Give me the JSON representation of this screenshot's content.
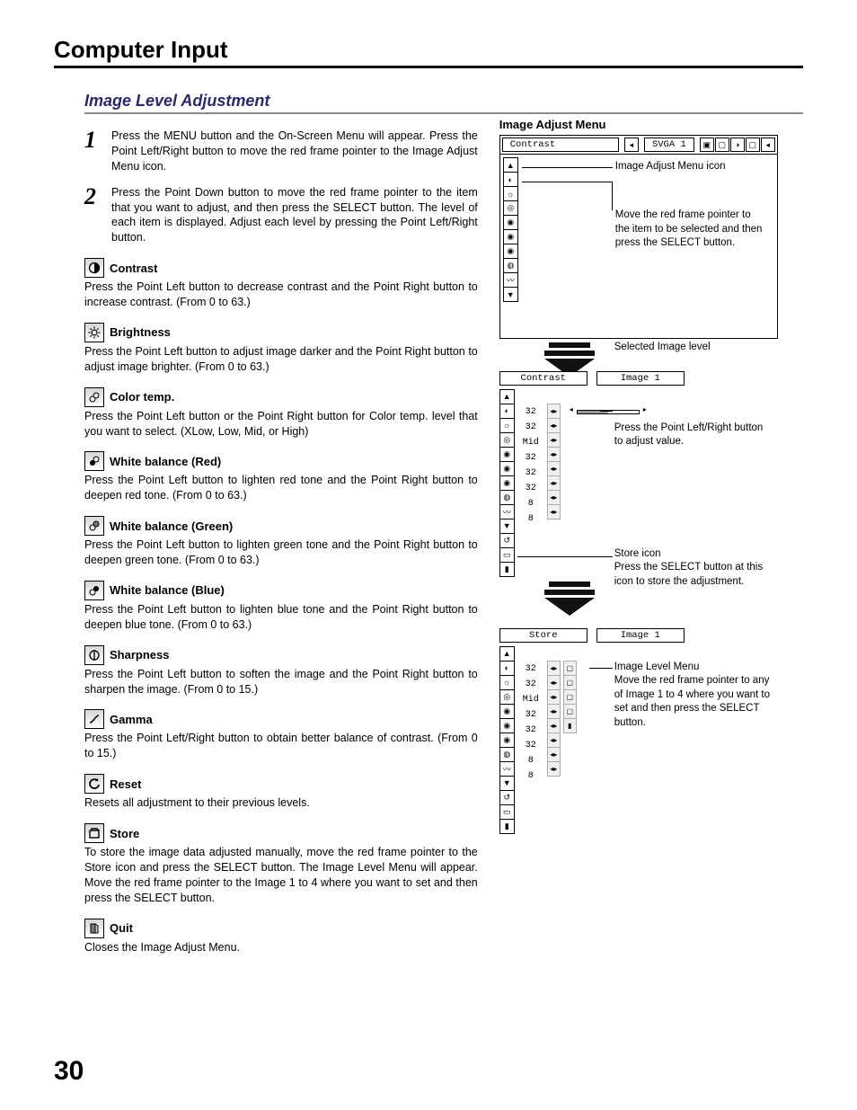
{
  "section_title": "Computer Input",
  "subsection_title": "Image Level Adjustment",
  "page_number": "30",
  "steps": {
    "1": {
      "num": "1",
      "text": "Press the MENU button and the On-Screen Menu will appear.  Press the Point Left/Right button to move the red frame pointer to the Image Adjust Menu icon."
    },
    "2": {
      "num": "2",
      "text": "Press the Point Down button to move the red frame pointer to the item that you want to adjust, and then press the SELECT button.  The level of each item is displayed.  Adjust each level by pressing the Point Left/Right button."
    }
  },
  "items": {
    "contrast": {
      "title": "Contrast",
      "body": "Press the Point Left button to decrease contrast and the Point Right button to increase contrast.  (From 0 to 63.)"
    },
    "brightness": {
      "title": "Brightness",
      "body": "Press the Point Left button to adjust image darker and the Point Right button to adjust image brighter.  (From 0 to 63.)"
    },
    "colortemp": {
      "title": "Color temp.",
      "body": "Press the Point Left button or the Point Right  button for Color temp. level that you want to select. (XLow, Low, Mid, or High)"
    },
    "wb_red": {
      "title": "White balance (Red)",
      "body": "Press the Point Left button to lighten red tone and the Point Right button to deepen red tone.  (From 0 to 63.)"
    },
    "wb_green": {
      "title": "White balance (Green)",
      "body": "Press the Point Left button to lighten green tone and the Point Right button to deepen green tone.  (From 0 to 63.)"
    },
    "wb_blue": {
      "title": "White balance (Blue)",
      "body": "Press the Point Left button to lighten blue tone and the Point Right button to deepen blue tone.  (From 0 to 63.)"
    },
    "sharpness": {
      "title": "Sharpness",
      "body": "Press the Point Left button to soften the image and the Point Right button to sharpen the image.  (From 0 to 15.)"
    },
    "gamma": {
      "title": "Gamma",
      "body": "Press the Point Left/Right  button to obtain better balance of contrast.  (From 0 to 15.)"
    },
    "reset": {
      "title": "Reset",
      "body": "Resets all adjustment to their previous levels."
    },
    "store": {
      "title": "Store",
      "body": "To store the image data adjusted manually, move the red frame pointer to the Store icon and press the SELECT button.  The Image Level Menu will appear.  Move the red frame pointer to the Image 1 to 4 where you want to set and then press the SELECT button."
    },
    "quit": {
      "title": "Quit",
      "body": "Closes the Image Adjust Menu."
    }
  },
  "right": {
    "heading": "Image Adjust Menu",
    "topbar": {
      "label": "Contrast",
      "source": "SVGA 1"
    },
    "callout1": "Image Adjust Menu icon",
    "callout2": "Move the red frame pointer to the item to be selected and then press the SELECT button.",
    "callout_selected": "Selected Image level",
    "menu2": {
      "left": "Contrast",
      "right": "Image 1"
    },
    "callout3": "Press the Point Left/Right button to adjust value.",
    "values2": {
      "contrast": "32",
      "brightness": "32",
      "colortemp": "Mid",
      "wb_r": "32",
      "wb_g": "32",
      "wb_b": "32",
      "sharp": "8",
      "gamma": "8"
    },
    "callout_store_t": "Store icon",
    "callout_store": "Press the SELECT button at this icon to store the adjustment.",
    "menu3": {
      "left": "Store",
      "right": "Image 1"
    },
    "values3": {
      "contrast": "32",
      "brightness": "32",
      "colortemp": "Mid",
      "wb_r": "32",
      "wb_g": "32",
      "wb_b": "32",
      "sharp": "8",
      "gamma": "8"
    },
    "callout_img_t": "Image Level Menu",
    "callout_img": "Move the red frame pointer to any of Image 1 to 4 where you want to set  and then press the SELECT button."
  }
}
